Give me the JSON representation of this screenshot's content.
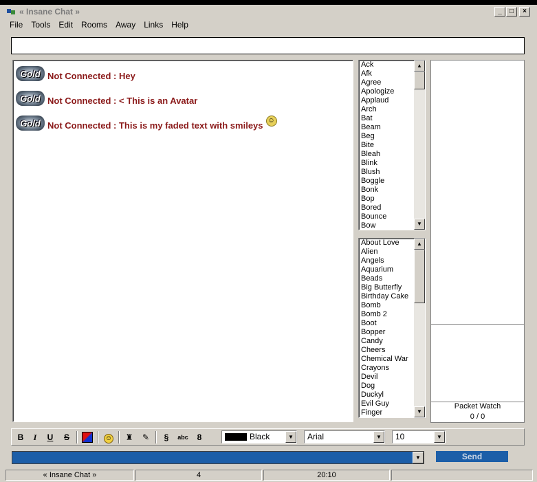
{
  "window": {
    "title": "« Insane Chat »",
    "controls": [
      "_",
      "□",
      "×"
    ]
  },
  "menu": [
    "File",
    "Tools",
    "Edit",
    "Rooms",
    "Away",
    "Links",
    "Help"
  ],
  "top_input": {
    "value": ""
  },
  "chat": {
    "messages": [
      {
        "avatar": "Gold",
        "text": "Not Connected : Hey",
        "color": "#8b1a1a"
      },
      {
        "avatar": "Gold",
        "text": "Not Connected : < This is an Avatar",
        "color": "#8b1a1a"
      },
      {
        "avatar": "Gold",
        "text": "Not Connected : This is my faded text with smileys",
        "color": "#8b1a1a",
        "smiley": true
      }
    ]
  },
  "actions_list": [
    "Ack",
    "Afk",
    "Agree",
    "Apologize",
    "Applaud",
    "Arch",
    "Bat",
    "Beam",
    "Beg",
    "Bite",
    "Bleah",
    "Blink",
    "Blush",
    "Boggle",
    "Bonk",
    "Bop",
    "Bored",
    "Bounce",
    "Bow"
  ],
  "avatars_list": [
    "About Love",
    "Alien",
    "Angels",
    "Aquarium",
    "Beads",
    "Big Butterfly",
    "Birthday Cake",
    "Bomb",
    "Bomb 2",
    "Boot",
    "Bopper",
    "Candy",
    "Cheers",
    "Chemical War",
    "Crayons",
    "Devil",
    "Dog",
    "Duckyl",
    "Evil Guy",
    "Finger"
  ],
  "packet_watch": {
    "label": "Packet Watch",
    "value": "0 / 0"
  },
  "toolbar": {
    "bold": "B",
    "italic": "I",
    "underline": "U",
    "strike": "S",
    "color_select": "Black",
    "font_select": "Arial",
    "size_select": "10",
    "section_symbol": "§"
  },
  "send_label": "Send",
  "status": {
    "app": "« Insane Chat »",
    "count": "4",
    "time": "20:10"
  }
}
